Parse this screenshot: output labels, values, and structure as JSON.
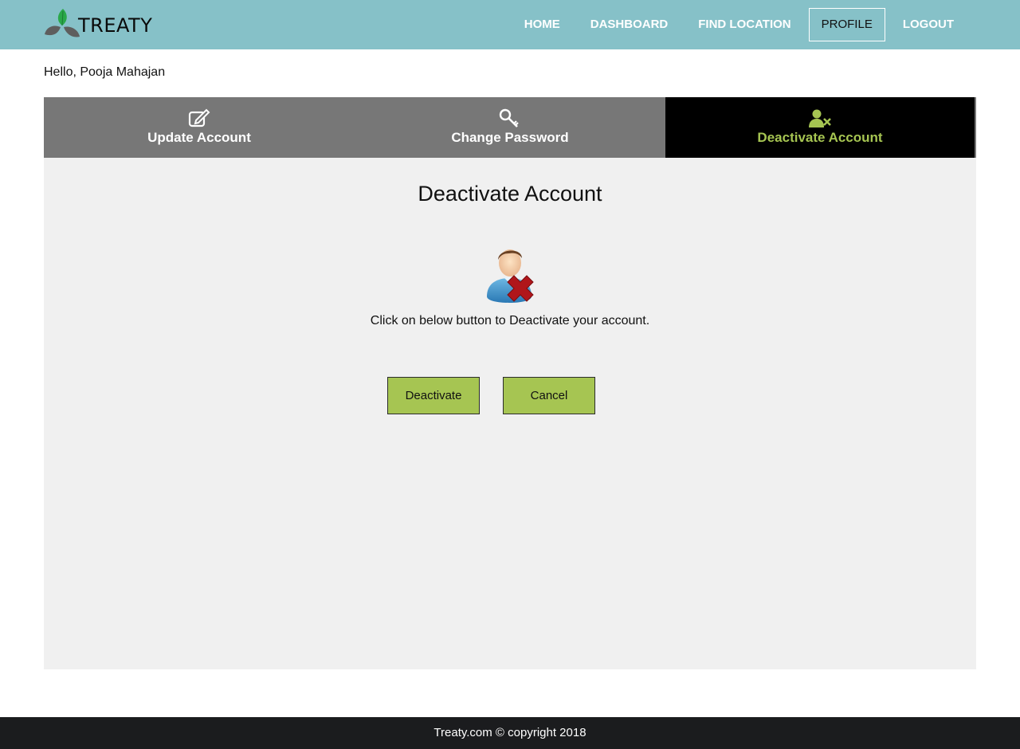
{
  "brand": {
    "name": "TREATY",
    "logo_icon": "three-leaf-logo"
  },
  "nav": {
    "items": [
      {
        "label": "HOME",
        "active": false
      },
      {
        "label": "DASHBOARD",
        "active": false
      },
      {
        "label": "FIND LOCATION",
        "active": false
      },
      {
        "label": "PROFILE",
        "active": true
      },
      {
        "label": "LOGOUT",
        "active": false
      }
    ]
  },
  "greeting": "Hello, Pooja Mahajan",
  "tabs": [
    {
      "label": "Update Account",
      "icon": "edit-icon",
      "active": false
    },
    {
      "label": "Change Password",
      "icon": "key-icon",
      "active": false
    },
    {
      "label": "Deactivate Account",
      "icon": "user-remove-icon",
      "active": true
    }
  ],
  "panel": {
    "title": "Deactivate Account",
    "illustration": "user-deactivate-illustration",
    "instruction": "Click on below button to Deactivate your account.",
    "deactivate_label": "Deactivate",
    "cancel_label": "Cancel"
  },
  "footer": {
    "text": "Treaty.com © copyright 2018"
  },
  "colors": {
    "navbar": "#86c1c8",
    "tab_bg": "#777777",
    "tab_active_bg": "#000000",
    "accent": "#a6c552",
    "panel_bg": "#f0f0f0",
    "footer_bg": "#1b1c1e"
  }
}
